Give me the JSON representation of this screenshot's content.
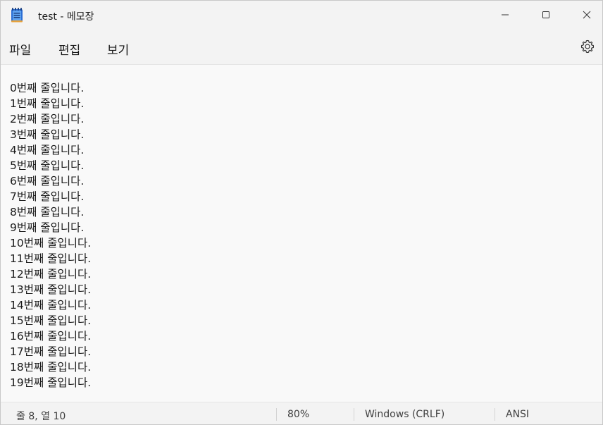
{
  "window": {
    "title": "test - 메모장",
    "icon": "notepad-icon",
    "controls": [
      "minimize-icon",
      "maximize-icon",
      "close-icon"
    ]
  },
  "menu": {
    "file": "파일",
    "edit": "편집",
    "view": "보기",
    "settings_icon": "gear-icon"
  },
  "editor": {
    "lines": [
      "0번째 줄입니다.",
      "1번째 줄입니다.",
      "2번째 줄입니다.",
      "3번째 줄입니다.",
      "4번째 줄입니다.",
      "5번째 줄입니다.",
      "6번째 줄입니다.",
      "7번째 줄입니다.",
      "8번째 줄입니다.",
      "9번째 줄입니다.",
      "10번째 줄입니다.",
      "11번째 줄입니다.",
      "12번째 줄입니다.",
      "13번째 줄입니다.",
      "14번째 줄입니다.",
      "15번째 줄입니다.",
      "16번째 줄입니다.",
      "17번째 줄입니다.",
      "18번째 줄입니다.",
      "19번째 줄입니다."
    ]
  },
  "status": {
    "position": "줄 8, 열 10",
    "zoom": "80%",
    "line_ending": "Windows (CRLF)",
    "encoding": "ANSI"
  },
  "colors": {
    "chrome_bg": "#f3f3f3",
    "editor_bg": "#f9f9f9",
    "text": "#1a1a1a",
    "notepad_icon_blue": "#2b6fd6"
  }
}
